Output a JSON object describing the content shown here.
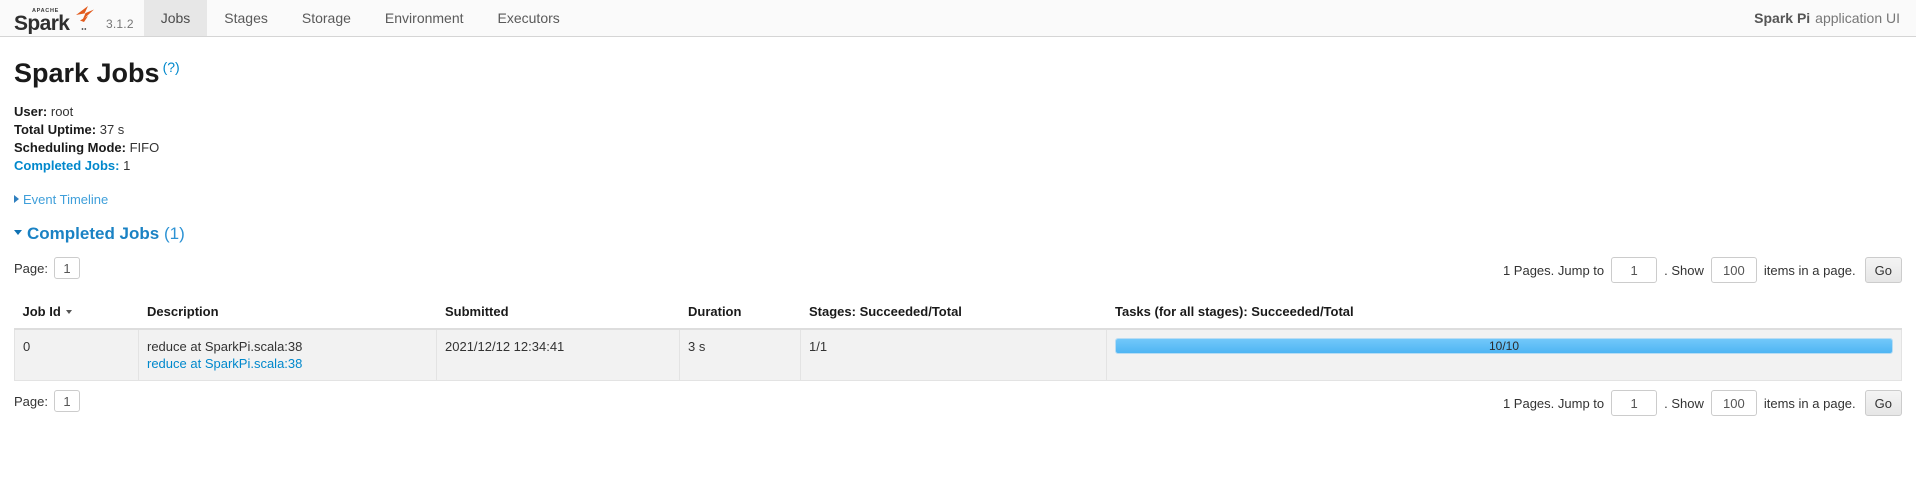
{
  "navbar": {
    "logo_apache": "APACHE",
    "logo_spark": "Spark",
    "version": "3.1.2",
    "tabs": [
      {
        "label": "Jobs",
        "active": true
      },
      {
        "label": "Stages",
        "active": false
      },
      {
        "label": "Storage",
        "active": false
      },
      {
        "label": "Environment",
        "active": false
      },
      {
        "label": "Executors",
        "active": false
      }
    ],
    "app_name": "Spark Pi",
    "app_suffix": "application UI"
  },
  "page": {
    "title": "Spark Jobs",
    "help_label": "(?)"
  },
  "summary": {
    "user_label": "User:",
    "user_value": "root",
    "uptime_label": "Total Uptime:",
    "uptime_value": "37 s",
    "scheduling_label": "Scheduling Mode:",
    "scheduling_value": "FIFO",
    "completed_label": "Completed Jobs:",
    "completed_value": "1"
  },
  "event_timeline": {
    "label": "Event Timeline"
  },
  "completed_section": {
    "label": "Completed Jobs",
    "count": "(1)"
  },
  "pagination": {
    "page_label": "Page:",
    "page_value": "1",
    "pages_text": "1 Pages. Jump to",
    "jump_value": "1",
    "show_text": ". Show",
    "show_value": "100",
    "items_text": "items in a page.",
    "go_label": "Go"
  },
  "table": {
    "headers": [
      "Job Id",
      "Description",
      "Submitted",
      "Duration",
      "Stages: Succeeded/Total",
      "Tasks (for all stages): Succeeded/Total"
    ],
    "rows": [
      {
        "job_id": "0",
        "description_main": "reduce at SparkPi.scala:38",
        "description_link": "reduce at SparkPi.scala:38",
        "submitted": "2021/12/12 12:34:41",
        "duration": "3 s",
        "stages": "1/1",
        "tasks_label": "10/10",
        "tasks_percent": 100
      }
    ]
  },
  "colors": {
    "link": "#0088cc",
    "progress_fill": "#5cbef8",
    "accent_orange": "#e25a1c",
    "section_heading": "#1a82c4"
  }
}
